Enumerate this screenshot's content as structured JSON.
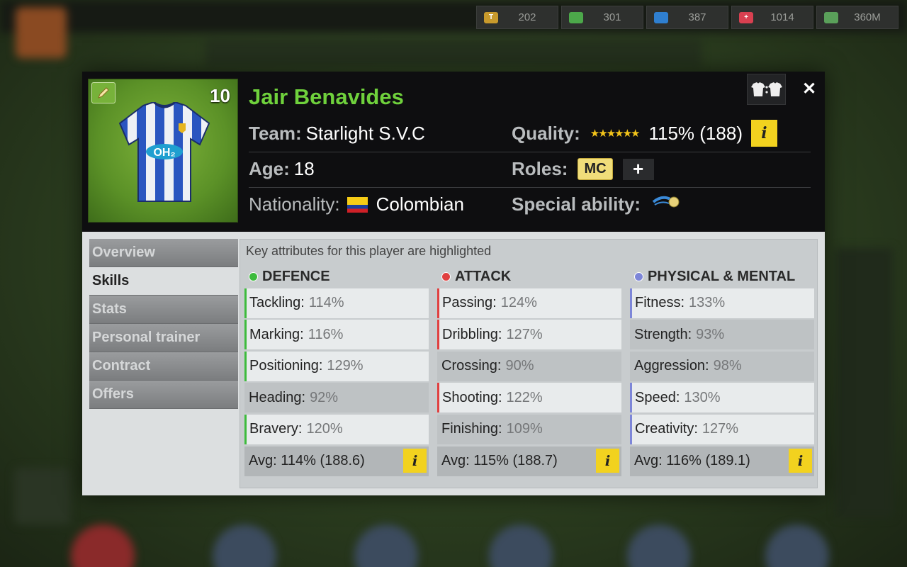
{
  "currency": [
    {
      "icon": "token-coin-icon",
      "value": "202",
      "color": "#c89a2c",
      "glyph": "T"
    },
    {
      "icon": "cash-icon",
      "value": "301",
      "color": "#4ca84a",
      "glyph": ""
    },
    {
      "icon": "energy-icon",
      "value": "387",
      "color": "#2f7fd0",
      "glyph": ""
    },
    {
      "icon": "health-icon",
      "value": "1014",
      "color": "#d94050",
      "glyph": "+"
    },
    {
      "icon": "money-icon",
      "value": "360M",
      "color": "#5aa05a",
      "glyph": ""
    }
  ],
  "player": {
    "number": "10",
    "name": "Jair Benavides",
    "team_label": "Team:",
    "team": "Starlight S.V.C",
    "age_label": "Age:",
    "age": "18",
    "nationality_label": "Nationality:",
    "nationality": "Colombian",
    "quality_label": "Quality:",
    "quality": "115% (188)",
    "roles_label": "Roles:",
    "role": "MC",
    "special_label": "Special ability:",
    "shirt_text": "OH₂"
  },
  "buttons": {
    "compare": "•:•",
    "close": "✕",
    "add_role": "+",
    "info": "i"
  },
  "menu": [
    {
      "label": "Overview",
      "active": false
    },
    {
      "label": "Skills",
      "active": true
    },
    {
      "label": "Stats",
      "active": false
    },
    {
      "label": "Personal trainer",
      "active": false
    },
    {
      "label": "Contract",
      "active": false
    },
    {
      "label": "Offers",
      "active": false
    }
  ],
  "hint": "Key attributes for this player are highlighted",
  "groups": [
    {
      "title": "DEFENCE",
      "color": "#3dbb3d",
      "attrs": [
        {
          "label": "Tackling:",
          "value": "114%",
          "key": true
        },
        {
          "label": "Marking:",
          "value": "116%",
          "key": true
        },
        {
          "label": "Positioning:",
          "value": "129%",
          "key": true
        },
        {
          "label": "Heading:",
          "value": "92%",
          "key": false
        },
        {
          "label": "Bravery:",
          "value": "120%",
          "key": true
        }
      ],
      "avg": "Avg: 114% (188.6)"
    },
    {
      "title": "ATTACK",
      "color": "#e04040",
      "attrs": [
        {
          "label": "Passing:",
          "value": "124%",
          "key": true
        },
        {
          "label": "Dribbling:",
          "value": "127%",
          "key": true
        },
        {
          "label": "Crossing:",
          "value": "90%",
          "key": false
        },
        {
          "label": "Shooting:",
          "value": "122%",
          "key": true
        },
        {
          "label": "Finishing:",
          "value": "109%",
          "key": false
        }
      ],
      "avg": "Avg: 115% (188.7)"
    },
    {
      "title": "PHYSICAL & MENTAL",
      "color": "#7d86d8",
      "attrs": [
        {
          "label": "Fitness:",
          "value": "133%",
          "key": true
        },
        {
          "label": "Strength:",
          "value": "93%",
          "key": false
        },
        {
          "label": "Aggression:",
          "value": "98%",
          "key": false
        },
        {
          "label": "Speed:",
          "value": "130%",
          "key": true
        },
        {
          "label": "Creativity:",
          "value": "127%",
          "key": true
        }
      ],
      "avg": "Avg: 116% (189.1)"
    }
  ]
}
